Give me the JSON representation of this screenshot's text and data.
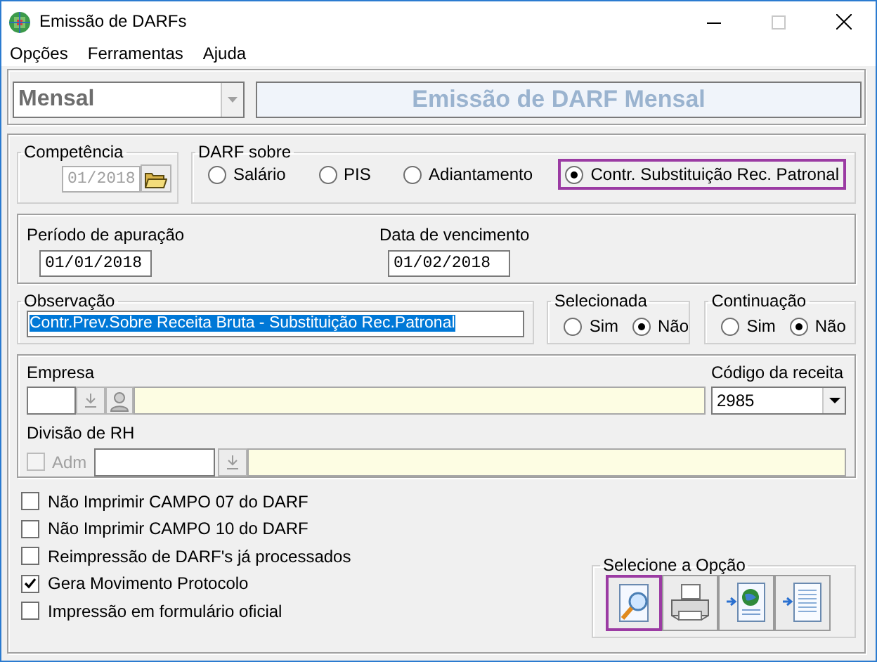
{
  "window": {
    "title": "Emissão de DARFs"
  },
  "menu": [
    {
      "label": "Opções"
    },
    {
      "label": "Ferramentas"
    },
    {
      "label": "Ajuda"
    }
  ],
  "period_select": {
    "value": "Mensal",
    "disabled": true
  },
  "header_title": "Emissão de DARF Mensal",
  "competencia": {
    "label": "Competência",
    "value": "01/2018",
    "disabled": true
  },
  "darf_sobre": {
    "label": "DARF sobre",
    "options": [
      {
        "label": "Salário",
        "selected": false,
        "highlighted": false
      },
      {
        "label": "PIS",
        "selected": false,
        "highlighted": false
      },
      {
        "label": "Adiantamento",
        "selected": false,
        "highlighted": false
      },
      {
        "label": "Contr. Substituição Rec. Patronal",
        "selected": true,
        "highlighted": true
      }
    ]
  },
  "periodo_apuracao": {
    "label": "Período de apuração",
    "value": "01/01/2018"
  },
  "data_vencimento": {
    "label": "Data de vencimento",
    "value": "01/02/2018"
  },
  "observacao": {
    "label": "Observação",
    "value": "Contr.Prev.Sobre Receita Bruta - Substituição Rec.Patronal",
    "text_selected": true
  },
  "selecionada": {
    "label": "Selecionada",
    "options": [
      {
        "label": "Sim",
        "selected": false
      },
      {
        "label": "Não",
        "selected": true
      }
    ]
  },
  "continuacao": {
    "label": "Continuação",
    "options": [
      {
        "label": "Sim",
        "selected": false
      },
      {
        "label": "Não",
        "selected": true
      }
    ]
  },
  "empresa": {
    "label": "Empresa"
  },
  "codigo_receita": {
    "label": "Código da receita",
    "value": "2985"
  },
  "divisao_rh": {
    "label": "Divisão de RH",
    "adm": {
      "label": "Adm",
      "checked": false,
      "disabled": true
    }
  },
  "checkboxes": [
    {
      "label": "Não Imprimir CAMPO 07 do DARF",
      "checked": false
    },
    {
      "label": "Não Imprimir CAMPO 10 do DARF",
      "checked": false
    },
    {
      "label": "Reimpressão de DARF's já processados",
      "checked": false
    },
    {
      "label": "Gera Movimento Protocolo",
      "checked": true
    },
    {
      "label": "Impressão em formulário oficial",
      "checked": false
    }
  ],
  "options_group": {
    "label": "Selecione a Opção",
    "buttons": [
      {
        "kind": "preview",
        "selected": true
      },
      {
        "kind": "print",
        "selected": false
      },
      {
        "kind": "web",
        "selected": false
      },
      {
        "kind": "document",
        "selected": false
      }
    ]
  }
}
